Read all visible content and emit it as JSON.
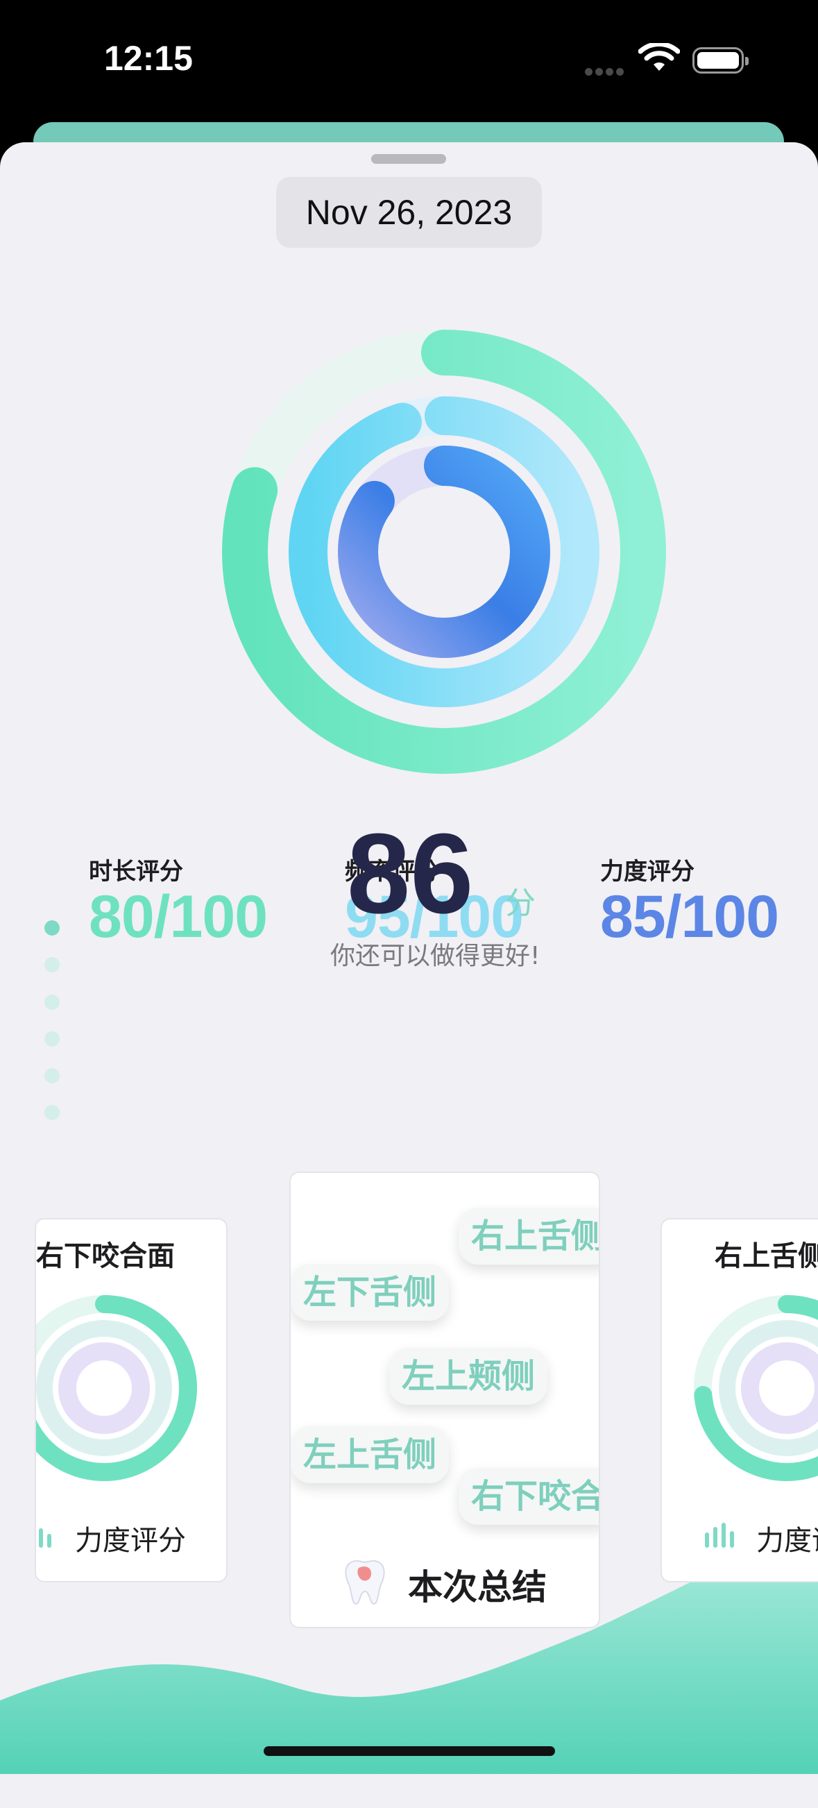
{
  "status_bar": {
    "time": "12:15"
  },
  "header": {
    "date": "Nov 26, 2023"
  },
  "colors": {
    "duration": "#6ee1c1",
    "frequency": "#8edcf2",
    "strength": "#5b86e5",
    "total": "#25274a",
    "accent": "#7fd9c7"
  },
  "rings": [
    {
      "metric": "duration",
      "score": 80
    },
    {
      "metric": "frequency",
      "score": 95
    },
    {
      "metric": "strength",
      "score": 85
    }
  ],
  "scores": [
    {
      "label": "时长评分",
      "value": "80/100",
      "color": "#6ee1c1"
    },
    {
      "label": "频率评分",
      "value": "95/100",
      "color": "#8edcf2"
    },
    {
      "label": "力度评分",
      "value": "85/100",
      "color": "#5b86e5"
    }
  ],
  "total": {
    "value": "86",
    "unit": "分",
    "message": "你还可以做得更好!"
  },
  "pager": {
    "count": 6,
    "active": 0
  },
  "cards": {
    "left": {
      "title": "右下咬合面",
      "footer": "力度评分"
    },
    "center": {
      "regions": [
        "右上舌侧",
        "左下舌侧",
        "左上颊侧",
        "左上舌侧",
        "右下咬合"
      ],
      "footer": "本次总结"
    },
    "right": {
      "title": "右上舌侧",
      "footer": "力度评分"
    }
  }
}
